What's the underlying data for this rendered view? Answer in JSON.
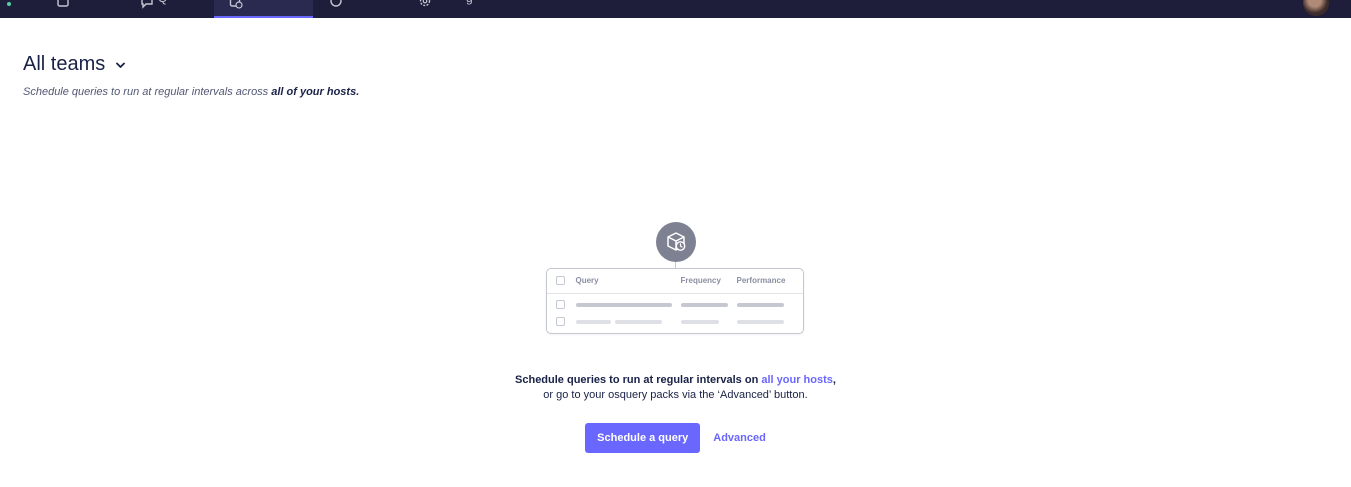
{
  "nav": {
    "items": [
      {
        "icon": "hosts-icon",
        "label": ""
      },
      {
        "icon": "queries-icon",
        "label": "Q"
      },
      {
        "icon": "schedule-icon",
        "label": "",
        "active": true
      },
      {
        "icon": "policies-icon",
        "label": ""
      },
      {
        "icon": "settings-icon",
        "label": "g"
      }
    ],
    "active_color": "#6a67fe",
    "background": "#1f1e3a"
  },
  "header": {
    "team_title": "All teams",
    "subtitle_prefix": "Schedule queries to run at regular intervals across",
    "subtitle_emphasis": "all of your hosts."
  },
  "illustration": {
    "columns": [
      "Query",
      "Frequency",
      "Performance"
    ]
  },
  "empty_state": {
    "line1_prefix": "Schedule queries to run at regular intervals on",
    "line1_link": "all your hosts",
    "line1_suffix": ",",
    "line2": "or go to your osquery packs via the ‘Advanced’ button."
  },
  "actions": {
    "schedule_label": "Schedule a query",
    "advanced_label": "Advanced"
  }
}
